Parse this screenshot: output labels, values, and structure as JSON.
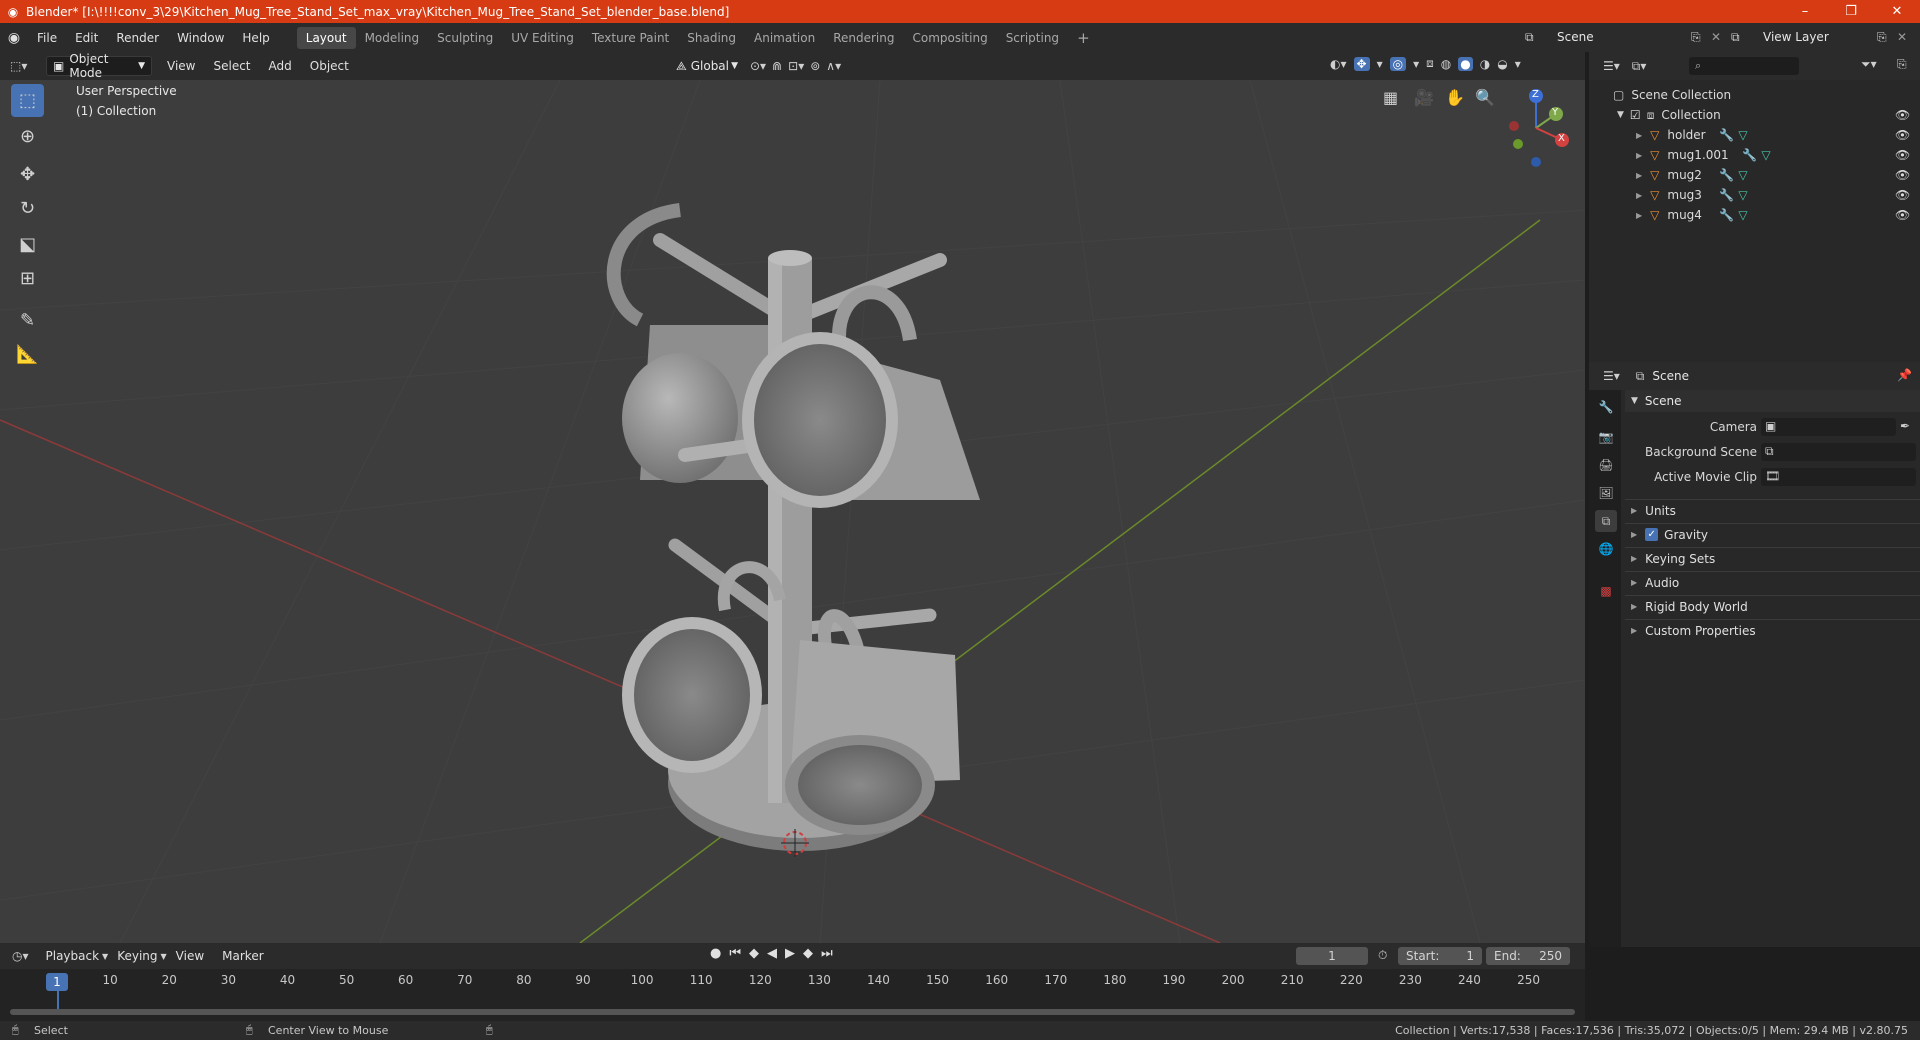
{
  "window": {
    "title": "Blender* [I:\\!!!!conv_3\\29\\Kitchen_Mug_Tree_Stand_Set_max_vray\\Kitchen_Mug_Tree_Stand_Set_blender_base.blend]",
    "minimize": "–",
    "maximize": "❐",
    "close": "✕"
  },
  "menu": {
    "items": [
      "File",
      "Edit",
      "Render",
      "Window",
      "Help"
    ],
    "workspaces": [
      "Layout",
      "Modeling",
      "Sculpting",
      "UV Editing",
      "Texture Paint",
      "Shading",
      "Animation",
      "Rendering",
      "Compositing",
      "Scripting"
    ],
    "active_workspace": "Layout",
    "add_workspace": "+",
    "scene_name": "Scene",
    "view_layer_name": "View Layer"
  },
  "viewport_header": {
    "mode": "Object Mode",
    "menus": [
      "View",
      "Select",
      "Add",
      "Object"
    ],
    "transform_orientation": "Global"
  },
  "viewport": {
    "perspective_label": "User Perspective",
    "collection_label": "(1) Collection",
    "gizmo": {
      "x": "X",
      "y": "Y",
      "z": "Z"
    },
    "colors": {
      "background": "#3d3d3d",
      "x_axis": "#8b3a3a",
      "y_axis": "#6b8a2a",
      "mesh": "#9a9a9a"
    }
  },
  "outliner": {
    "root": "Scene Collection",
    "collection": "Collection",
    "objects": [
      {
        "name": "holder"
      },
      {
        "name": "mug1.001"
      },
      {
        "name": "mug2"
      },
      {
        "name": "mug3"
      },
      {
        "name": "mug4"
      }
    ]
  },
  "properties": {
    "context": "Scene",
    "panel_title": "Scene",
    "fields": [
      {
        "label": "Camera",
        "value": ""
      },
      {
        "label": "Background Scene",
        "value": ""
      },
      {
        "label": "Active Movie Clip",
        "value": ""
      }
    ],
    "sections": [
      "Units",
      "Gravity",
      "Keying Sets",
      "Audio",
      "Rigid Body World",
      "Custom Properties"
    ],
    "gravity_checked": true
  },
  "timeline": {
    "menus": [
      "Playback",
      "Keying",
      "View",
      "Marker"
    ],
    "current_frame": "1",
    "start_label": "Start:",
    "start": "1",
    "end_label": "End:",
    "end": "250",
    "ruler": [
      "1",
      "10",
      "20",
      "30",
      "40",
      "50",
      "60",
      "70",
      "80",
      "90",
      "100",
      "110",
      "120",
      "130",
      "140",
      "150",
      "160",
      "170",
      "180",
      "190",
      "200",
      "210",
      "220",
      "230",
      "240",
      "250"
    ]
  },
  "status": {
    "select": "Select",
    "center_view": "Center View to Mouse",
    "stats": "Collection | Verts:17,538 | Faces:17,536 | Tris:35,072 | Objects:0/5 | Mem: 29.4 MB | v2.80.75"
  },
  "accent_color": "#4772b3",
  "title_bar_color": "#d63b13"
}
